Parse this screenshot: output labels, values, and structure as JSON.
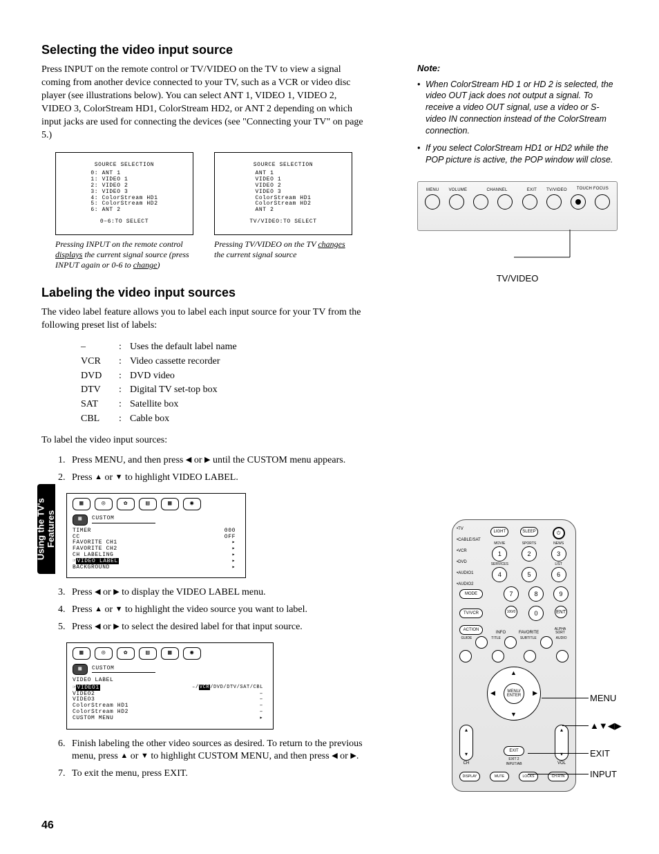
{
  "section_tab": "Using the TV's Features",
  "page_number": "46",
  "h1": "Selecting the video input source",
  "intro": "Press INPUT on the remote control or TV/VIDEO on the TV to view a signal coming from another device connected to your TV, such as a VCR or video disc player (see illustrations below). You can select ANT 1, VIDEO 1, VIDEO 2, VIDEO 3, ColorStream HD1, ColorStream HD2, or ANT 2 depending on which input jacks are used for connecting the devices (see \"Connecting your TV\" on page 5.)",
  "osd_a": {
    "title": "SOURCE SELECTION",
    "items": [
      "0: ANT 1",
      "1: VIDEO 1",
      "2: VIDEO 2",
      "3: VIDEO 3",
      "4: ColorStream HD1",
      "5: ColorStream HD2",
      "6: ANT 2"
    ],
    "footer": "0–6:TO SELECT"
  },
  "osd_b": {
    "title": "SOURCE SELECTION",
    "items": [
      "ANT 1",
      "VIDEO 1",
      "VIDEO 2",
      "VIDEO 3",
      "ColorStream HD1",
      "ColorStream HD2",
      "ANT 2"
    ],
    "footer": "TV/VIDEO:TO SELECT"
  },
  "cap_a_pre": "Pressing INPUT on the remote control ",
  "cap_a_u": "displays",
  "cap_a_post": " the current signal source (press INPUT again or 0-6 to ",
  "cap_a_u2": "change",
  "cap_a_end": ")",
  "cap_b_pre": "Pressing TV/VIDEO on the TV ",
  "cap_b_u": "changes",
  "cap_b_post": " the current signal source",
  "h2": "Labeling the video input sources",
  "label_intro": "The video label feature allows you to label each input source for your TV from the following preset list of labels:",
  "labels": [
    {
      "k": "–",
      "v": "Uses the default label name"
    },
    {
      "k": "VCR",
      "v": "Video cassette recorder"
    },
    {
      "k": "DVD",
      "v": "DVD video"
    },
    {
      "k": "DTV",
      "v": "Digital TV set-top box"
    },
    {
      "k": "SAT",
      "v": "Satellite box"
    },
    {
      "k": "CBL",
      "v": "Cable box"
    }
  ],
  "steps_lead": "To label the video input sources:",
  "step1a": "Press MENU, and then press ",
  "step1b": " or ",
  "step1c": " until the CUSTOM menu appears.",
  "step2a": "Press ",
  "step2b": " or ",
  "step2c": " to highlight VIDEO LABEL.",
  "menu1": {
    "title": "CUSTOM",
    "rows": [
      {
        "l": "TIMER",
        "r": "000"
      },
      {
        "l": "CC",
        "r": "OFF"
      },
      {
        "l": "FAVORITE CH1",
        "r": "▸"
      },
      {
        "l": "FAVORITE CH2",
        "r": "▸"
      },
      {
        "l": "CH LABELING",
        "r": "▸"
      },
      {
        "l": "VIDEO LABEL",
        "r": "▸",
        "hl": true
      },
      {
        "l": "BACKGROUND",
        "r": "▸"
      }
    ]
  },
  "step3a": "Press ",
  "step3c": " to display the VIDEO LABEL menu.",
  "step4a": "Press ",
  "step4c": " to highlight the video source you want to label.",
  "step5a": "Press ",
  "step5c": " to select the desired label for that input source.",
  "menu2": {
    "title": "CUSTOM",
    "head": "VIDEO  LABEL",
    "rows": [
      {
        "l": "VIDEO1",
        "r": "VCR /DVD/DTV/SAT/CBL",
        "hl": true
      },
      {
        "l": "VIDEO2",
        "r": "–"
      },
      {
        "l": "VIDEO3",
        "r": "–"
      },
      {
        "l": "ColorStream HD1",
        "r": "–"
      },
      {
        "l": "ColorStream HD2",
        "r": "–"
      },
      {
        "l": "CUSTOM MENU",
        "r": "▸"
      }
    ]
  },
  "step6a": "Finish labeling the other video sources as desired. To return to the previous menu, press ",
  "step6c": " to highlight CUSTOM MENU, and then press ",
  "step6e": ".",
  "step7": "To exit the menu, press EXIT.",
  "note_head": "Note:",
  "notes": [
    "When ColorStream HD 1 or HD 2 is selected, the video OUT jack does not output a signal. To receive a video OUT signal, use a video or S-video IN connection instead of the ColorStream connection.",
    "If you select ColorStream HD1 or HD2 while the POP picture is active, the POP window will close."
  ],
  "panel_labels": [
    "MENU",
    "VOLUME",
    "",
    "CHANNEL",
    "",
    "EXIT",
    "TV/VIDEO",
    "TOUCH FOCUS"
  ],
  "panel_caption": "TV/VIDEO",
  "remote": {
    "side": [
      "•TV",
      "•CABLE/SAT",
      "•VCR",
      "•DVD",
      "•AUDIO1",
      "•AUDIO2"
    ],
    "row0": [
      "LIGHT",
      "SLEEP",
      "POWER"
    ],
    "row1_l": [
      "MOVIE",
      "SPORTS",
      "NEWS"
    ],
    "row1": [
      "1",
      "2",
      "3"
    ],
    "row2_l": [
      "SERVICES",
      "",
      "LIST"
    ],
    "row2": [
      "4",
      "5",
      "6"
    ],
    "row3": [
      "7",
      "8",
      "9"
    ],
    "row4": [
      "100/0",
      "0",
      "ENT"
    ],
    "mode": "MODE",
    "tvvcr": "TV/VCR",
    "action": "ACTION",
    "info": "INFO",
    "fav": "FAVORITE",
    "guide": "GUIDE",
    "title": "TITLE",
    "subtitle": "SUBTITLE",
    "audio": "AUDIO",
    "alpha": "ALPHA SORT",
    "menu_enter": "MENU/ ENTER",
    "ch": "CH",
    "vol": "VOL",
    "exit": "EXIT",
    "exit2": "EXIT 2",
    "input": "INPUT/AB",
    "bottom": [
      "DISPLAY",
      "MUTE",
      "LOCKS",
      "CH RTN"
    ],
    "callouts": [
      "MENU",
      "▲▼◀▶",
      "EXIT",
      "INPUT"
    ]
  }
}
